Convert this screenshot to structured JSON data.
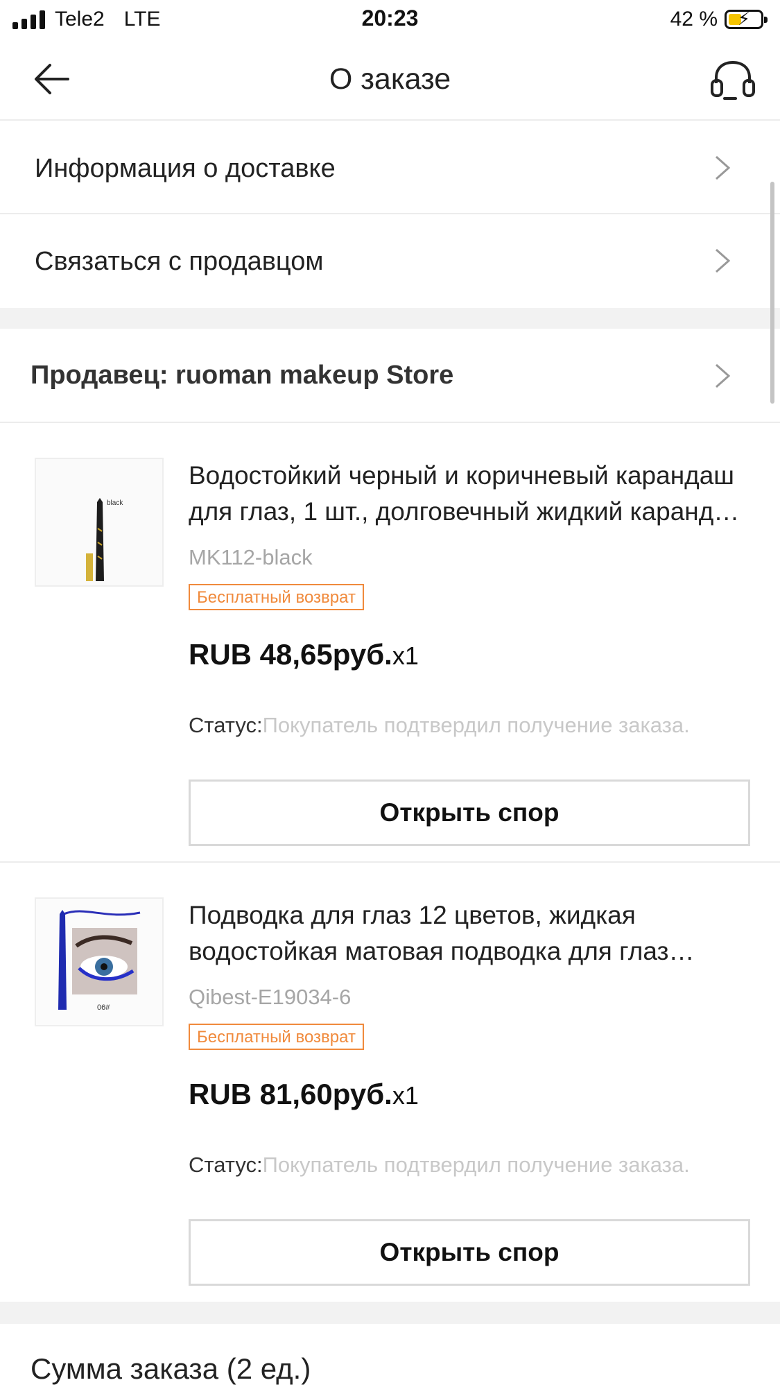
{
  "status_bar": {
    "carrier": "Tele2",
    "network": "LTE",
    "time": "20:23",
    "battery": "42 %",
    "battery_level": 0.42
  },
  "header": {
    "title": "О заказе",
    "back_icon": "arrow-left-icon",
    "support_icon": "headset-icon"
  },
  "menu": {
    "delivery_info": "Информация о доставке",
    "contact_seller": "Связаться с продавцом"
  },
  "seller": {
    "label": "Продавец: ruoman makeup Store"
  },
  "products": [
    {
      "title": "Водостойкий черный и коричневый карандаш для глаз, 1 шт., долговечный жидкий карандаш для глаз",
      "sku": "MK112-black",
      "badge": "Бесплатный возврат",
      "price": "RUB 48,65руб.",
      "qty": "x1",
      "status_label": "Статус:",
      "status_value": "Покупатель подтвердил получение заказа.",
      "dispute_button": "Открыть спор",
      "image_caption": "black"
    },
    {
      "title": "Подводка для глаз 12 цветов, жидкая водостойкая матовая подводка для глаз долговечная",
      "sku": "Qibest-E19034-6",
      "badge": "Бесплатный возврат",
      "price": "RUB 81,60руб.",
      "qty": "x1",
      "status_label": "Статус:",
      "status_value": "Покупатель подтвердил получение заказа.",
      "dispute_button": "Открыть спор",
      "image_caption": "06#"
    }
  ],
  "summary": {
    "label": "Сумма заказа (2 ед.)"
  },
  "colors": {
    "badge_orange": "#f08a3c",
    "status_gray": "#c8c8c8",
    "battery_yellow": "#f5c400"
  }
}
